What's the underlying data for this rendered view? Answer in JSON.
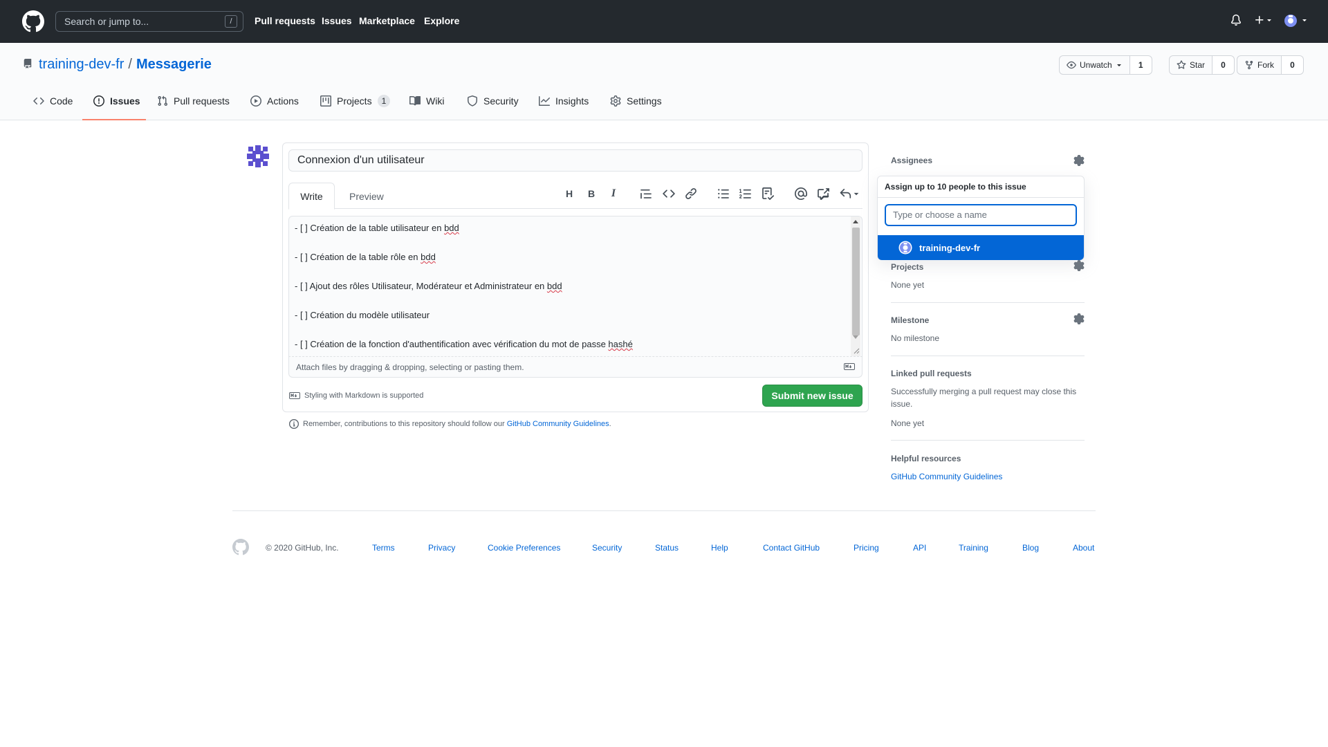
{
  "header": {
    "search_placeholder": "Search or jump to...",
    "slash_key": "/",
    "nav": [
      "Pull requests",
      "Issues",
      "Marketplace",
      "Explore"
    ]
  },
  "repo": {
    "owner": "training-dev-fr",
    "separator": "/",
    "name": "Messagerie",
    "watch_label": "Unwatch",
    "watch_count": "1",
    "star_label": "Star",
    "star_count": "0",
    "fork_label": "Fork",
    "fork_count": "0"
  },
  "tabs": [
    {
      "label": "Code",
      "icon": "code-icon"
    },
    {
      "label": "Issues",
      "icon": "issue-opened-icon",
      "selected": true
    },
    {
      "label": "Pull requests",
      "icon": "git-pull-request-icon"
    },
    {
      "label": "Actions",
      "icon": "play-icon"
    },
    {
      "label": "Projects",
      "icon": "project-icon",
      "counter": "1"
    },
    {
      "label": "Wiki",
      "icon": "book-icon"
    },
    {
      "label": "Security",
      "icon": "shield-icon"
    },
    {
      "label": "Insights",
      "icon": "graph-icon"
    },
    {
      "label": "Settings",
      "icon": "gear-icon"
    }
  ],
  "issue": {
    "title_value": "Connexion d'un utilisateur",
    "write_tab": "Write",
    "preview_tab": "Preview",
    "body_lines": [
      [
        "- [ ] Création de la table utilisateur en ",
        "bdd",
        ""
      ],
      [
        "- [ ] Création de la table rôle en ",
        "bdd",
        ""
      ],
      [
        "- [ ] Ajout des rôles Utilisateur, Modérateur et Administrateur en ",
        "bdd",
        ""
      ],
      [
        "- [ ] Création du modèle utilisateur",
        "",
        ""
      ],
      [
        "- [ ] Création de la fonction d'authentification avec vérification du mot de passe ",
        "hashé",
        ""
      ]
    ],
    "attach_text": "Attach files by dragging & dropping, selecting or pasting them.",
    "markdown_note": "Styling with Markdown is supported",
    "submit_label": "Submit new issue",
    "reminder_text": "Remember, contributions to this repository should follow our ",
    "reminder_link": "GitHub Community Guidelines",
    "reminder_end": "."
  },
  "sidebar": {
    "assignees_heading": "Assignees",
    "dropdown_header": "Assign up to 10 people to this issue",
    "filter_placeholder": "Type or choose a name",
    "dropdown_user": "training-dev-fr",
    "projects_heading": "Projects",
    "projects_value": "None yet",
    "milestone_heading": "Milestone",
    "milestone_value": "No milestone",
    "linked_heading": "Linked pull requests",
    "linked_desc_1": "Successfully merging a pull request may close this",
    "linked_desc_2": "issue.",
    "linked_value": "None yet",
    "helpful_heading": "Helpful resources",
    "helpful_link": "GitHub Community Guidelines"
  },
  "footer": {
    "copyright": "© 2020 GitHub, Inc.",
    "links": [
      "Terms",
      "Privacy",
      "Cookie Preferences",
      "Security",
      "Status",
      "Help",
      "Contact GitHub",
      "Pricing",
      "API",
      "Training",
      "Blog",
      "About"
    ]
  },
  "colors": {
    "header_bg": "#24292e",
    "link": "#0366d6",
    "primary_button": "#2ea44f",
    "tab_underline": "#f9826c"
  }
}
